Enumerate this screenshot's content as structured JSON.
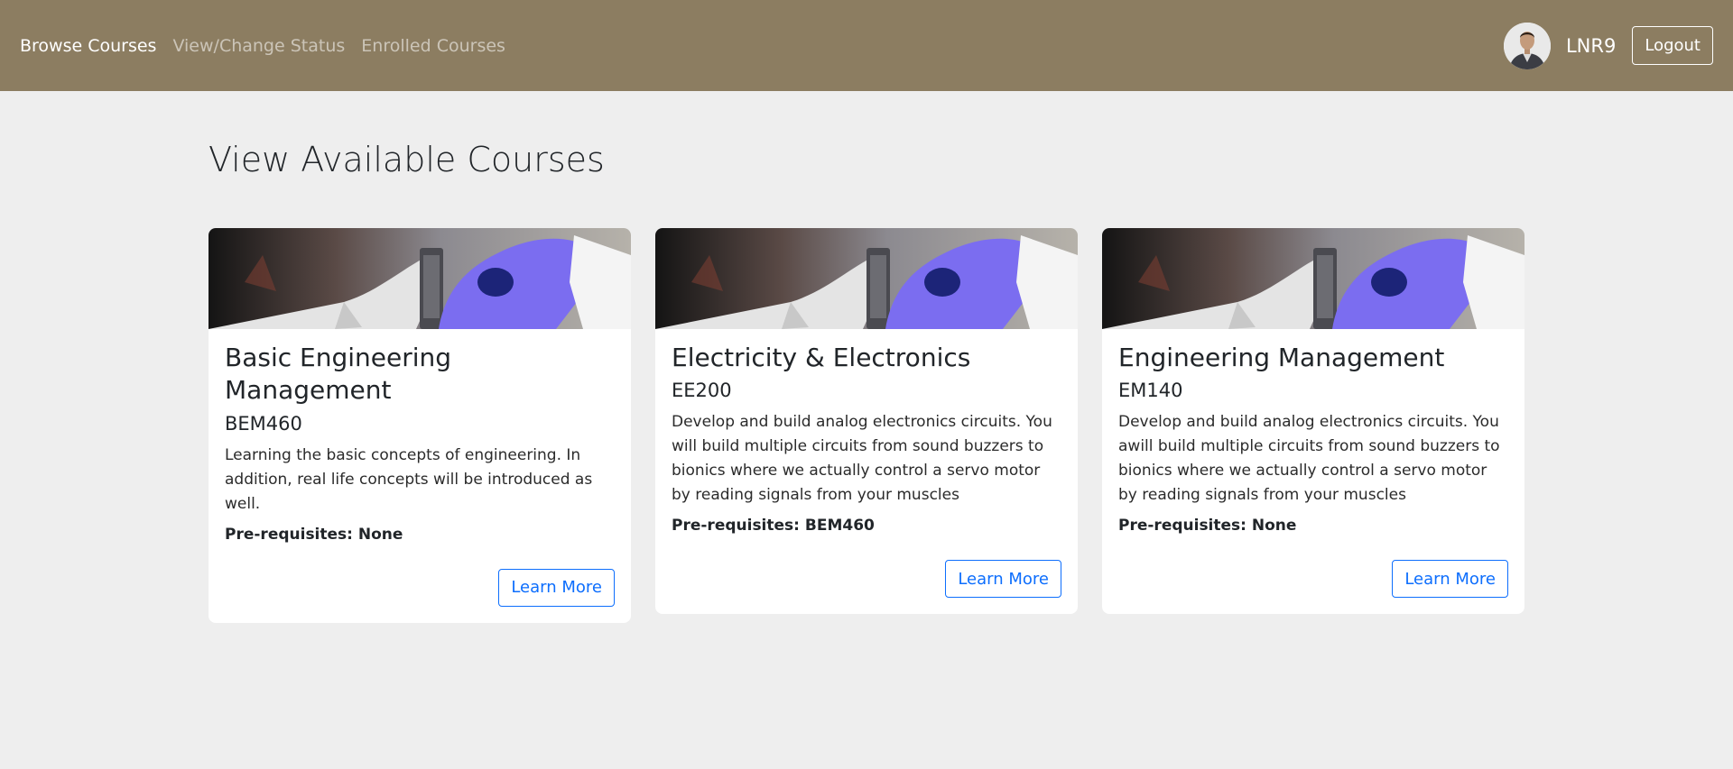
{
  "nav": {
    "links": [
      "Browse Courses",
      "View/Change Status",
      "Enrolled Courses"
    ],
    "username": "LNR9",
    "logout_label": "Logout",
    "avatar_icon": "user-avatar-icon"
  },
  "main": {
    "title": "View Available Courses",
    "cards": [
      {
        "title": "Basic Engineering Management",
        "code": "BEM460",
        "description": "Learning the basic concepts of engineering. In addition, real life concepts will be introduced as well.",
        "prereq": "Pre-requisites: None",
        "button_label": "Learn More"
      },
      {
        "title": "Electricity & Electronics",
        "code": "EE200",
        "description": "Develop and build analog electronics circuits. You will build multiple circuits from sound buzzers to bionics where we actually control a servo motor by reading signals from your muscles",
        "prereq": "Pre-requisites: BEM460",
        "button_label": "Learn More"
      },
      {
        "title": "Engineering Management",
        "code": "EM140",
        "description": "Develop and build analog electronics circuits. You awill build multiple circuits from sound buzzers to bionics where we actually control a servo motor by reading signals from your muscles",
        "prereq": "Pre-requisites: None",
        "button_label": "Learn More"
      }
    ]
  },
  "colors": {
    "navbar": "#8c7d61",
    "background": "#eeeeee",
    "accent": "#0d6efd"
  }
}
